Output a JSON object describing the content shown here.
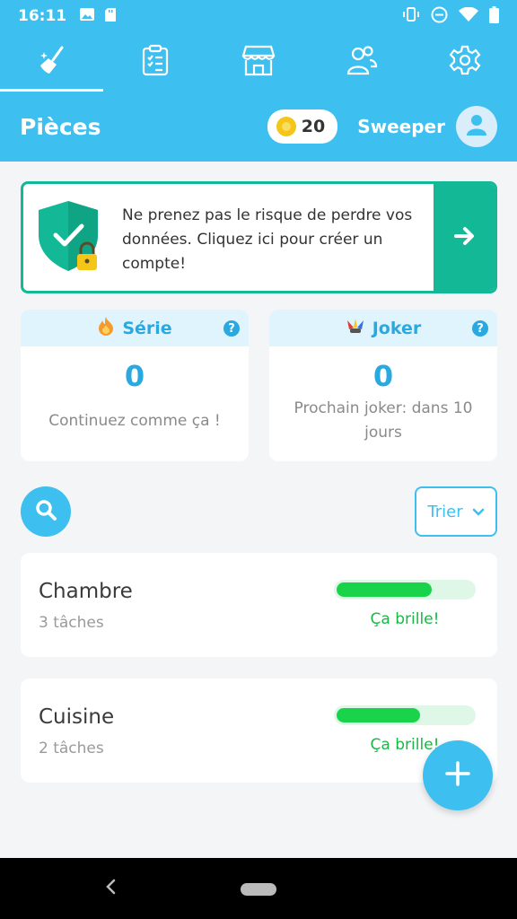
{
  "status_bar": {
    "time": "16:11"
  },
  "nav": {
    "tabs": [
      {
        "icon": "broom-icon",
        "active": true
      },
      {
        "icon": "clipboard-checklist-icon",
        "active": false
      },
      {
        "icon": "shop-icon",
        "active": false
      },
      {
        "icon": "people-icon",
        "active": false
      },
      {
        "icon": "gear-icon",
        "active": false
      }
    ]
  },
  "header": {
    "title": "Pièces",
    "coins": "20",
    "username": "Sweeper"
  },
  "banner": {
    "text": "Ne prenez pas le risque de perdre vos données. Cliquez ici pour créer un compte!"
  },
  "stats": {
    "serie": {
      "label": "Série",
      "value": "0",
      "caption": "Continuez comme ça !"
    },
    "joker": {
      "label": "Joker",
      "value": "0",
      "caption": "Prochain joker: dans 10 jours"
    }
  },
  "help_glyph": "?",
  "sort": {
    "label": "Trier"
  },
  "rooms": [
    {
      "name": "Chambre",
      "count": "3 tâches",
      "status": "Ça brille!",
      "progress": 0.7
    },
    {
      "name": "Cuisine",
      "count": "2 tâches",
      "status": "Ça brille!",
      "progress": 0.61
    }
  ],
  "colors": {
    "primary": "#3dbfef",
    "accent_green": "#13b896",
    "progress_green": "#19d44a"
  }
}
